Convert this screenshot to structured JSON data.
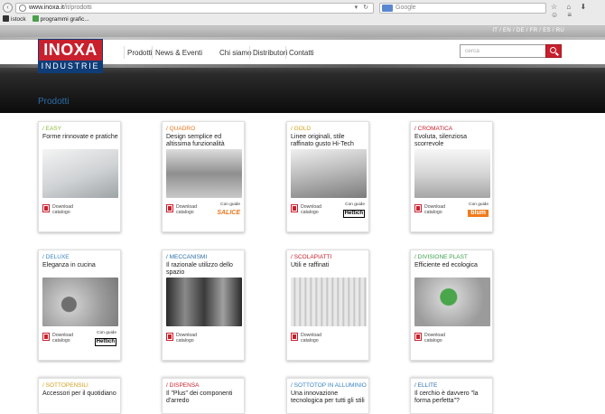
{
  "browser": {
    "url_host": "www.inoxa.it",
    "url_path": "/it/prodotti",
    "search_placeholder": "Google",
    "bookmarks": [
      "istock",
      "programmi grafic..."
    ]
  },
  "header": {
    "languages": "IT / EN / DE / FR / ES / RU",
    "logo_top": "INOXA",
    "logo_bottom": "INDUSTRIE",
    "menu": [
      "Prodotti",
      "News & Eventi",
      "Chi siamo",
      "Distributori",
      "Contatti"
    ],
    "search_placeholder": "cerca"
  },
  "page": {
    "title": "Prodotti",
    "download_line1": "Download",
    "download_line2": "catalogo",
    "con_guide": "Con guide"
  },
  "products": [
    {
      "name": "EASY",
      "desc": "Forme rinnovate e pratiche",
      "accent": "#8fb93a",
      "brand": ""
    },
    {
      "name": "QUADRO",
      "desc": "Design semplice ed altissima funzionalità",
      "accent": "#e8761d",
      "brand": "SALICE"
    },
    {
      "name": "GOLD",
      "desc": "Linee originali, stile raffinato gusto Hi-Tech",
      "accent": "#d4a020",
      "brand": "Hettich"
    },
    {
      "name": "CROMATICA",
      "desc": "Evoluta, silenziosa scorrevole",
      "accent": "#c8202d",
      "brand": "blum"
    },
    {
      "name": "DELUXE",
      "desc": "Eleganza in cucina",
      "accent": "#3a84c4",
      "brand": "Hettich"
    },
    {
      "name": "MECCANISMI",
      "desc": "Il razionale utilizzo dello spazio",
      "accent": "#2b6ea8",
      "brand": ""
    },
    {
      "name": "SCOLAPIATTI",
      "desc": "Utili e raffinati",
      "accent": "#c8202d",
      "brand": ""
    },
    {
      "name": "DIVISIONE PLAST",
      "desc": "Efficiente ed ecologica",
      "accent": "#3aa04a",
      "brand": ""
    },
    {
      "name": "SOTTOPENSILI",
      "desc": "Accessori per il quotidiano",
      "accent": "#d4a020",
      "brand": ""
    },
    {
      "name": "DISPENSA",
      "desc": "Il \"Plus\" dei componenti d'arredo",
      "accent": "#c8202d",
      "brand": ""
    },
    {
      "name": "SOTTOTOP IN ALLUMINIO",
      "desc": "Una innovazione tecnologica per tutti gli stili",
      "accent": "#3a84c4",
      "brand": ""
    },
    {
      "name": "ELLITE",
      "desc": "Il cerchio è davvero \"la forma perfetta\"?",
      "accent": "#2b6ea8",
      "brand": ""
    }
  ],
  "colors": {
    "brand_red": "#c8202d",
    "brand_blue": "#0f3d78",
    "title_blue": "#2b6ea8"
  }
}
